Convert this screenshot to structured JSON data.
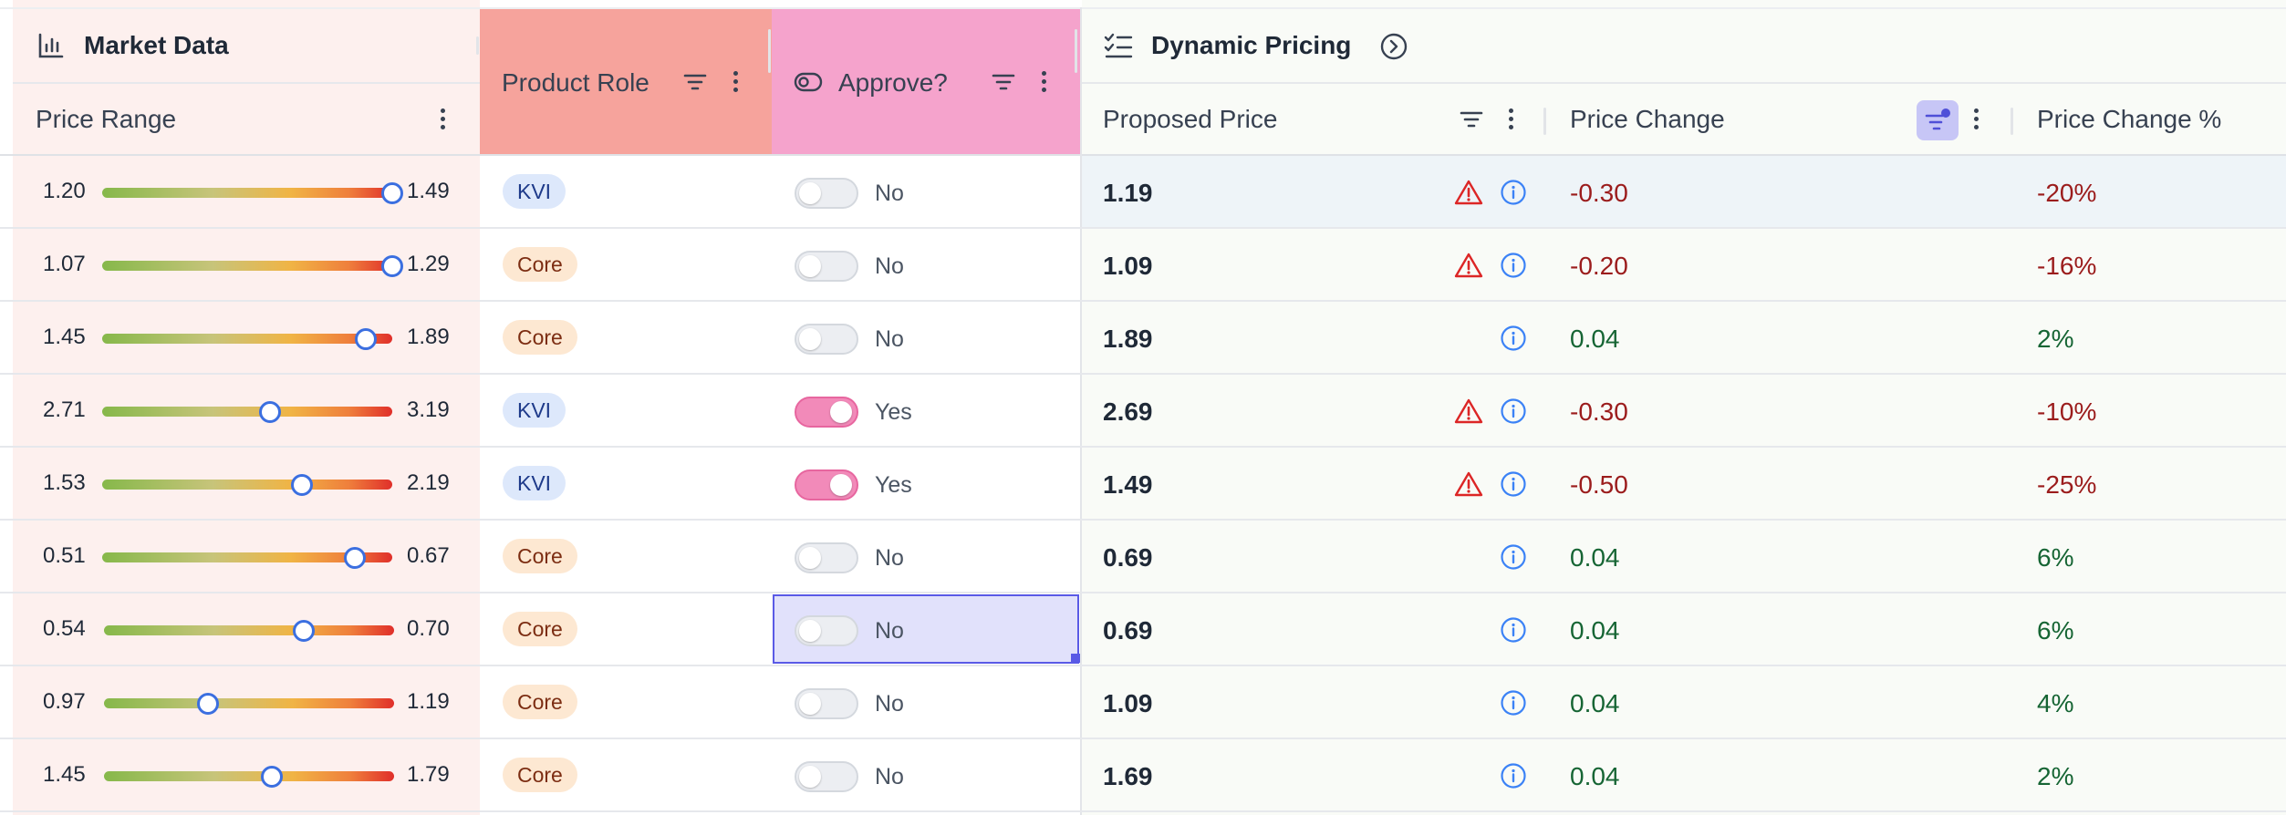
{
  "header": {
    "market_group": "Market Data",
    "dynamic_group": "Dynamic Pricing",
    "columns": {
      "price_range": "Price Range",
      "product_role": "Product Role",
      "approve": "Approve?",
      "proposed_price": "Proposed Price",
      "price_change": "Price Change",
      "price_change_pct": "Price Change %"
    }
  },
  "colors": {
    "market_bg": "#fdf0ee",
    "product_role_header": "#f6a39c",
    "approve_header": "#f5a3cc",
    "negative": "#9b1c1c",
    "positive": "#166534",
    "selection": "#5a5ae6"
  },
  "rows": [
    {
      "min": "1.20",
      "max": "1.49",
      "position": 1.0,
      "role": "KVI",
      "approve": "No",
      "on": false,
      "price": "1.19",
      "warning": true,
      "change": "-0.30",
      "pct": "-20%"
    },
    {
      "min": "1.07",
      "max": "1.29",
      "position": 1.0,
      "role": "Core",
      "approve": "No",
      "on": false,
      "price": "1.09",
      "warning": true,
      "change": "-0.20",
      "pct": "-16%"
    },
    {
      "min": "1.45",
      "max": "1.89",
      "position": 0.91,
      "role": "Core",
      "approve": "No",
      "on": false,
      "price": "1.89",
      "warning": false,
      "change": "0.04",
      "pct": "2%"
    },
    {
      "min": "2.71",
      "max": "3.19",
      "position": 0.58,
      "role": "KVI",
      "approve": "Yes",
      "on": true,
      "price": "2.69",
      "warning": true,
      "change": "-0.30",
      "pct": "-10%"
    },
    {
      "min": "1.53",
      "max": "2.19",
      "position": 0.69,
      "role": "KVI",
      "approve": "Yes",
      "on": true,
      "price": "1.49",
      "warning": true,
      "change": "-0.50",
      "pct": "-25%"
    },
    {
      "min": "0.51",
      "max": "0.67",
      "position": 0.87,
      "role": "Core",
      "approve": "No",
      "on": false,
      "price": "0.69",
      "warning": false,
      "change": "0.04",
      "pct": "6%"
    },
    {
      "min": "0.54",
      "max": "0.70",
      "position": 0.69,
      "role": "Core",
      "approve": "No",
      "on": false,
      "price": "0.69",
      "warning": false,
      "change": "0.04",
      "pct": "6%"
    },
    {
      "min": "0.97",
      "max": "1.19",
      "position": 0.36,
      "role": "Core",
      "approve": "No",
      "on": false,
      "price": "1.09",
      "warning": false,
      "change": "0.04",
      "pct": "4%"
    },
    {
      "min": "1.45",
      "max": "1.79",
      "position": 0.58,
      "role": "Core",
      "approve": "No",
      "on": false,
      "price": "1.69",
      "warning": false,
      "change": "0.04",
      "pct": "2%"
    }
  ],
  "icons": {
    "market": "bar-chart-icon",
    "dynamic": "checklist-icon",
    "expand": "chevron-right-circle-icon",
    "filter": "filter-icon",
    "approve": "toggle-icon",
    "warning": "warning-triangle-icon",
    "info": "info-circle-icon",
    "menu": "kebab-menu-icon"
  },
  "selection": {
    "row": 6,
    "column": "approve"
  },
  "highlighted_row": 0
}
